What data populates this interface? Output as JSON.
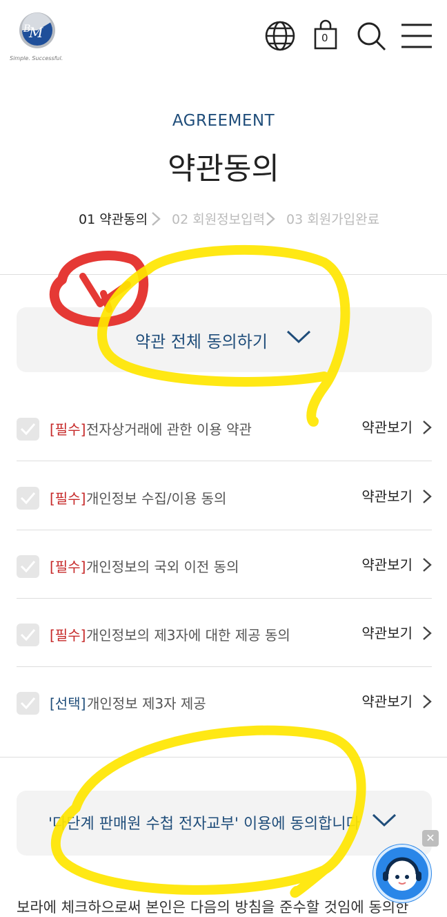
{
  "header": {
    "logo_text": "BM",
    "logo_tagline": "Simple. Successful.",
    "cart_count": "0",
    "icons": [
      "globe-icon",
      "cart-icon",
      "search-icon",
      "menu-icon"
    ]
  },
  "hero": {
    "eyebrow": "AGREEMENT",
    "title": "약관동의"
  },
  "steps": [
    {
      "label": "01 약관동의",
      "active": true
    },
    {
      "label": "02 회원정보입력",
      "active": false
    },
    {
      "label": "03 회원가입완료",
      "active": false
    }
  ],
  "all_agree": {
    "label": "약관 전체 동의하기"
  },
  "terms": [
    {
      "tag": "[필수]",
      "name": "전자상거래에 관한 이용 약관",
      "view": "약관보기",
      "type": "required"
    },
    {
      "tag": "[필수]",
      "name": "개인정보 수집/이용 동의",
      "view": "약관보기",
      "type": "required"
    },
    {
      "tag": "[필수]",
      "name": "개인정보의 국외 이전 동의",
      "view": "약관보기",
      "type": "required"
    },
    {
      "tag": "[필수]",
      "name": "개인정보의 제3자에 대한 제공 동의",
      "view": "약관보기",
      "type": "required"
    },
    {
      "tag": "[선택]",
      "name": "개인정보 제3자 제공",
      "view": "약관보기",
      "type": "optional"
    }
  ],
  "consent": {
    "label": "'다단계 판매원 수첩 전자교부' 이용에 동의합니다"
  },
  "bottom_text": "보라에 체크하으로써 본인은 다음의 방침을 준수할 것임에 동의한",
  "colors": {
    "accent": "#1f4d7a",
    "required": "#c62828",
    "highlight": "#ffe600",
    "annotation_red": "#e53935",
    "chatbot": "#2a86e8"
  }
}
